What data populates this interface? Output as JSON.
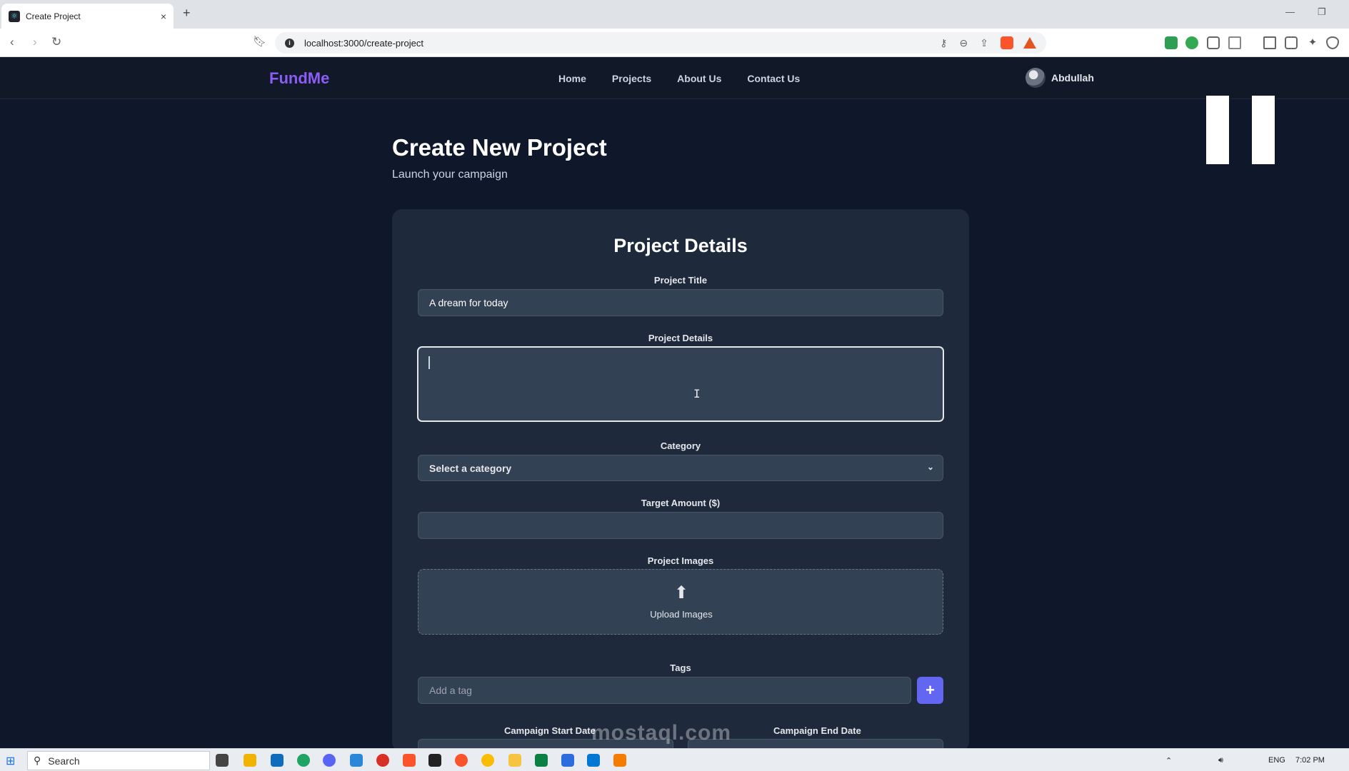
{
  "browser": {
    "tab_title": "Create Project",
    "url": "localhost:3000/create-project",
    "new_tab_label": "+",
    "close_label": "×"
  },
  "app": {
    "brand": "FundMe",
    "nav": [
      "Home",
      "Projects",
      "About Us",
      "Contact Us"
    ],
    "user_name": "Abdullah"
  },
  "page": {
    "title": "Create New Project",
    "subtitle": "Launch your campaign"
  },
  "form": {
    "section_title": "Project Details",
    "project_title_label": "Project Title",
    "project_title_value": "A dream for today",
    "project_details_label": "Project Details",
    "category_label": "Category",
    "category_selected": "Select a category",
    "target_label": "Target Amount ($)",
    "images_label": "Project Images",
    "upload_text": "Upload Images",
    "tags_label": "Tags",
    "tag_placeholder": "Add a tag",
    "add_tag_button": "+",
    "start_date_label": "Campaign Start Date",
    "end_date_label": "Campaign End Date"
  },
  "watermark": "mostaql.com",
  "taskbar": {
    "search_text": "Search",
    "language": "ENG",
    "time": "7:02 PM"
  },
  "colors": {
    "background": "#0f172a",
    "card": "#1e293b",
    "input": "#334155",
    "brand": "#8b5cf6",
    "accent_button": "#6366f1"
  }
}
